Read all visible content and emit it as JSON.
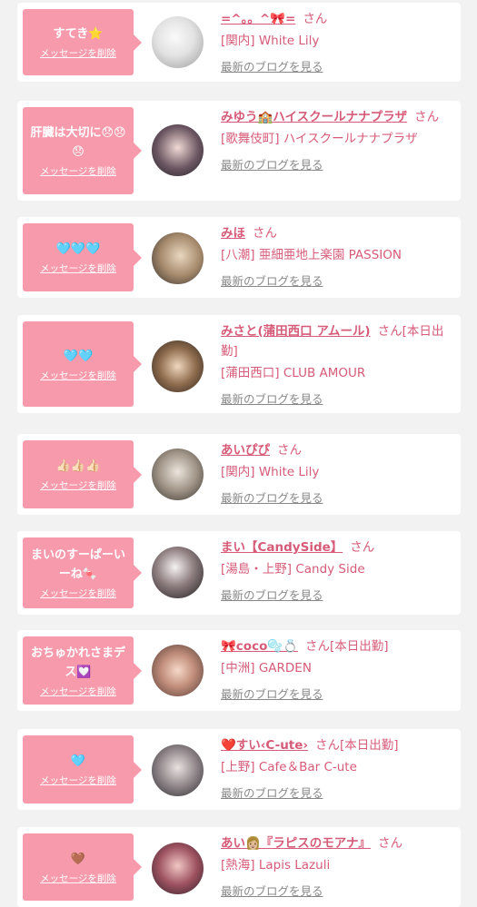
{
  "items": [
    {
      "message": "すてき⭐",
      "delete_label": "メッセージを削除",
      "name": "=^。。^🎀=",
      "honorific": "さん",
      "shop": "[関内] White Lily",
      "blog_label": "最新のブログを見る",
      "avatar_icon": "avatar-photo"
    },
    {
      "message": "肝臓は大切に😞😞😞",
      "delete_label": "メッセージを削除",
      "name": "みゆう🏫ハイスクールナナプラザ",
      "honorific": "さん",
      "shop": "[歌舞伎町] ハイスクールナナプラザ",
      "blog_label": "最新のブログを見る",
      "avatar_icon": "avatar-photo"
    },
    {
      "message": "🩵🩵🩵",
      "delete_label": "メッセージを削除",
      "name": "みほ",
      "honorific": "さん",
      "shop": "[八潮] 亜細亜地上楽園 PASSION",
      "blog_label": "最新のブログを見る",
      "avatar_icon": "avatar-photo"
    },
    {
      "message": "🩵🩵",
      "delete_label": "メッセージを削除",
      "name": "みさと(蒲田西口 アムール)",
      "honorific": "さん[本日出勤]",
      "shop": "[蒲田西口] CLUB AMOUR",
      "blog_label": "最新のブログを見る",
      "avatar_icon": "avatar-photo"
    },
    {
      "message": "👍🏻👍🏻👍🏻",
      "delete_label": "メッセージを削除",
      "name": "あいぴぴ",
      "honorific": "さん",
      "shop": "[関内] White Lily",
      "blog_label": "最新のブログを見る",
      "avatar_icon": "avatar-photo"
    },
    {
      "message": "まいのすーぱーいーね🍬",
      "delete_label": "メッセージを削除",
      "name": "まい【CandySide】",
      "honorific": "さん",
      "shop": "[湯島・上野] Candy Side",
      "blog_label": "最新のブログを見る",
      "avatar_icon": "avatar-photo"
    },
    {
      "message": "おちゅかれさまデス💟",
      "delete_label": "メッセージを削除",
      "name": "🎀coco🫧💍",
      "honorific": "さん[本日出勤]",
      "shop": "[中洲] GARDEN",
      "blog_label": "最新のブログを見る",
      "avatar_icon": "avatar-photo"
    },
    {
      "message": "🩵",
      "delete_label": "メッセージを削除",
      "name": "❤️すい‹C-ute›",
      "honorific": "さん[本日出勤]",
      "shop": "[上野] Cafe＆Bar C-ute",
      "blog_label": "最新のブログを見る",
      "avatar_icon": "avatar-photo"
    },
    {
      "message": "🤎",
      "delete_label": "メッセージを削除",
      "name": "あい👩🏼『ラピスのモアナ』",
      "honorific": "さん",
      "shop": "[熱海] Lapis Lazuli",
      "blog_label": "最新のブログを見る",
      "avatar_icon": "avatar-photo"
    }
  ],
  "colors": {
    "bubble": "#f79bac",
    "name": "#d65b78",
    "blog": "#888888",
    "background": "#f2f2f2"
  }
}
